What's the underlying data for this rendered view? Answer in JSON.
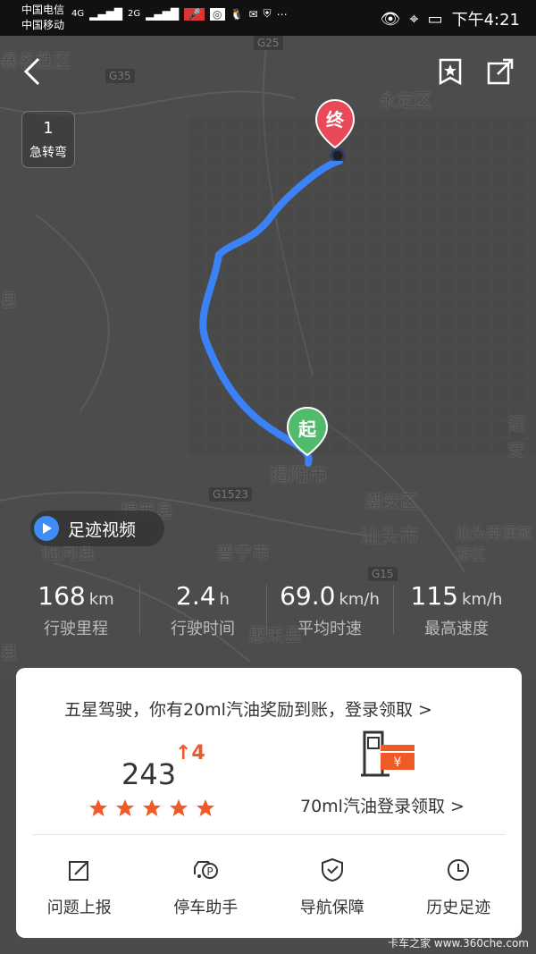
{
  "status_bar": {
    "carrier_1": "中国电信",
    "carrier_2": "中国移动",
    "network_1": "4G",
    "network_2": "2G",
    "time": "下午4:21"
  },
  "map": {
    "turn_count": "1",
    "turn_label": "急转弯",
    "places": [
      "永定区",
      "揭阳市",
      "揭西县",
      "陆河县",
      "普宁市",
      "潮安区",
      "汕头市",
      "汕头南澳旅游区",
      "惠来县",
      "诏安",
      "县",
      "县",
      "暴名胜区"
    ],
    "roads": [
      "G25",
      "G35",
      "G1523",
      "G15"
    ],
    "start_marker": "起",
    "end_marker": "终",
    "video_label": "足迹视频"
  },
  "stats": [
    {
      "value": "168",
      "unit": "km",
      "label": "行驶里程"
    },
    {
      "value": "2.4",
      "unit": "h",
      "label": "行驶时间"
    },
    {
      "value": "69.0",
      "unit": "km/h",
      "label": "平均时速"
    },
    {
      "value": "115",
      "unit": "km/h",
      "label": "最高速度"
    }
  ],
  "card": {
    "promo": "五星驾驶，你有20ml汽油奖励到账，登录领取 >",
    "score": "243",
    "score_change": "↑4",
    "stars": 5,
    "fuel_text": "70ml汽油登录领取 >",
    "actions": [
      {
        "label": "问题上报",
        "icon": "edit-icon"
      },
      {
        "label": "停车助手",
        "icon": "parking-icon"
      },
      {
        "label": "导航保障",
        "icon": "shield-icon"
      },
      {
        "label": "历史足迹",
        "icon": "clock-icon"
      }
    ]
  },
  "watermark": "卡车之家 www.360che.com",
  "colors": {
    "route": "#3b82f6",
    "end_marker": "#e84a5a",
    "start_marker": "#4fbb6b",
    "accent": "#f05a28"
  }
}
